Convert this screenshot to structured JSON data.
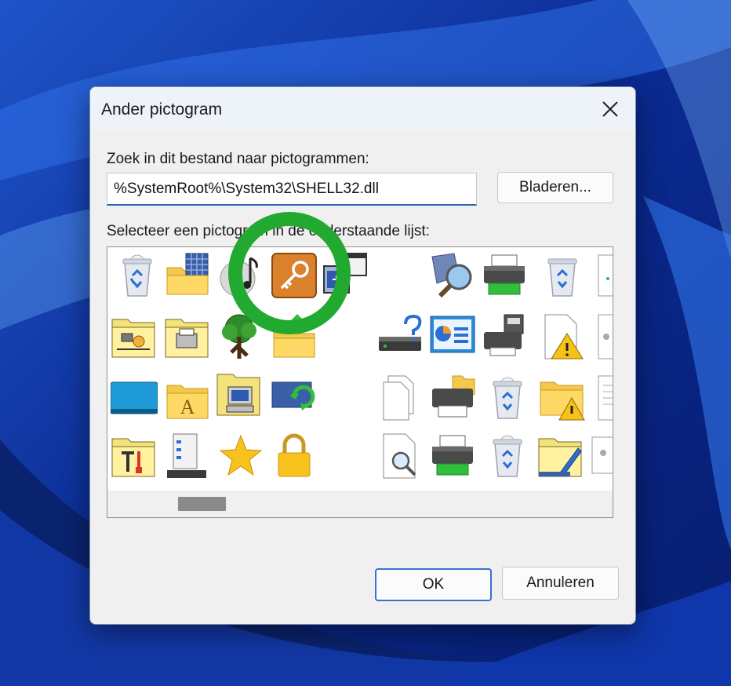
{
  "dialog": {
    "title": "Ander pictogram",
    "file_label": "Zoek in dit bestand naar pictogrammen:",
    "file_path": "%SystemRoot%\\System32\\SHELL32.dll",
    "browse_label": "Bladeren...",
    "list_label": "Selecteer een pictogram in de onderstaande lijst:",
    "ok_label": "OK",
    "cancel_label": "Annuleren"
  },
  "icons": [
    "recycle-bin-full-icon",
    "folder-grid-icon",
    "music-disc-icon",
    "key-icon",
    "monitor-window-icon",
    "network-search-icon",
    "printer-green-icon",
    "recycle-bin-icon",
    "network-folder-icon",
    "printer-folder-icon",
    "tree-icon",
    "folder-upload-icon",
    "drive-help-icon",
    "presentation-icon",
    "printer-fax-icon",
    "document-warning-icon",
    "monitor-blue-icon",
    "font-folder-icon",
    "computer-folder-icon",
    "sync-monitor-icon",
    "documents-icon",
    "printer-folder-icon",
    "recycle-bin-full-icon",
    "folder-warning-icon",
    "tools-folder-icon",
    "server-icon",
    "star-icon",
    "lock-icon",
    "search-document-icon",
    "printer-green-icon",
    "recycle-bin-full-icon",
    "folder-pen-icon"
  ],
  "colors": {
    "highlight_ring": "#22a930",
    "input_accent": "#2d63b5",
    "wallpaper": "#0b2c9e"
  }
}
